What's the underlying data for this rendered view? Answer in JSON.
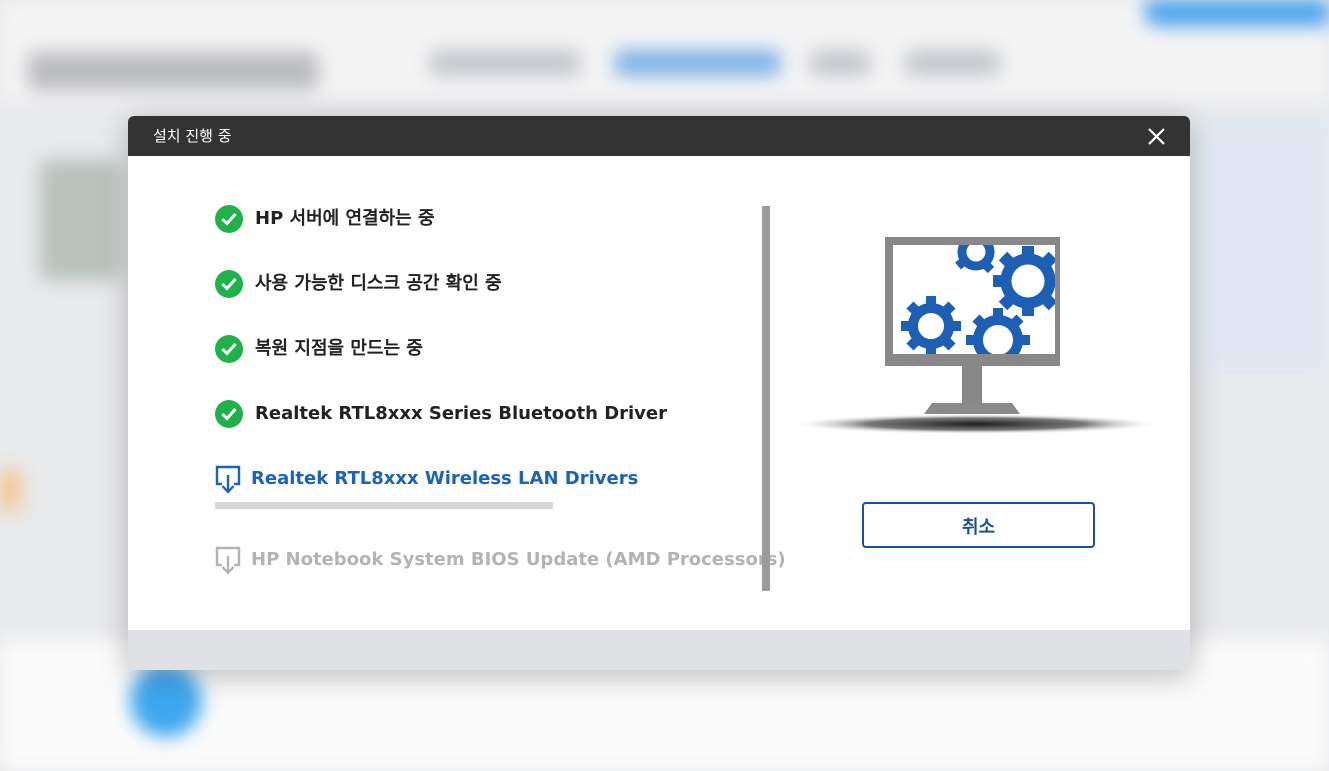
{
  "dialog": {
    "title": "설치 진행 중",
    "cancel_label": "취소"
  },
  "steps": [
    {
      "label": "HP 서버에 연결하는 중",
      "status": "done"
    },
    {
      "label": "사용 가능한 디스크 공간 확인 중",
      "status": "done"
    },
    {
      "label": "복원 지점을 만드는 중",
      "status": "done"
    },
    {
      "label": "Realtek RTL8xxx Series Bluetooth Driver",
      "status": "done"
    },
    {
      "label": "Realtek RTL8xxx Wireless LAN Drivers",
      "status": "downloading",
      "progress": 0
    },
    {
      "label": "HP Notebook System BIOS Update (AMD Processors)",
      "status": "pending"
    }
  ],
  "icons": [
    "close-icon",
    "check-icon",
    "download-icon",
    "monitor-gears-icon"
  ],
  "colors": {
    "accent": "#1b63b8",
    "success": "#1fb24a",
    "titlebar": "#333333",
    "pending_text": "#b3b3b3"
  }
}
